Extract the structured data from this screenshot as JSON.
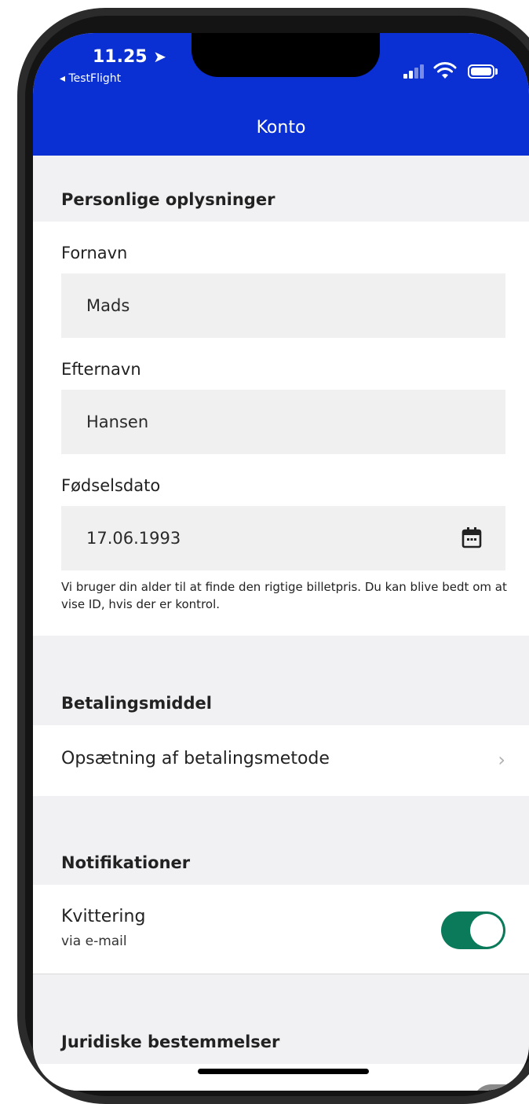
{
  "status_bar": {
    "time": "11.25",
    "location_arrow": "➤",
    "back_app": "◂ TestFlight",
    "signal_icon": "signal-icon",
    "wifi_icon": "wifi-icon",
    "battery_icon": "battery-icon"
  },
  "nav": {
    "title": "Konto"
  },
  "personal": {
    "header": "Personlige oplysninger",
    "first_name_label": "Fornavn",
    "first_name_value": "Mads",
    "last_name_label": "Efternavn",
    "last_name_value": "Hansen",
    "birthdate_label": "Fødselsdato",
    "birthdate_value": "17.06.1993",
    "birthdate_help": "Vi bruger din alder til at finde den rigtige billetpris. Du kan blive bedt om at vise ID, hvis der er kontrol."
  },
  "payment": {
    "header": "Betalingsmiddel",
    "setup_label": "Opsætning af betalingsmetode",
    "chevron": "›"
  },
  "notifications": {
    "header": "Notifikationer",
    "receipt_label": "Kvittering",
    "receipt_sub": "via e-mail",
    "receipt_enabled": true
  },
  "legal": {
    "header": "Juridiske bestemmelser"
  },
  "colors": {
    "brand_blue": "#0a2fd2",
    "toggle_on": "#0a7a5a"
  }
}
